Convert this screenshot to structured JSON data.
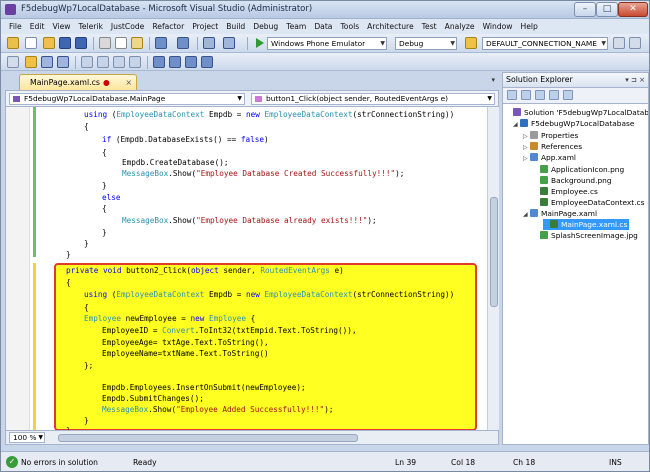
{
  "window": {
    "title": "F5debugWp7LocalDatabase - Microsoft Visual Studio (Administrator)"
  },
  "menu": [
    "File",
    "Edit",
    "View",
    "Telerik",
    "JustCode",
    "Refactor",
    "Project",
    "Build",
    "Debug",
    "Team",
    "Data",
    "Tools",
    "Architecture",
    "Test",
    "Analyze",
    "Window",
    "Help"
  ],
  "toolbar": {
    "target_device": "Windows Phone Emulator",
    "configuration": "Debug",
    "find_box": "DEFAULT_CONNECTION_NAME"
  },
  "editor": {
    "tab_label": "MainPage.xaml.cs",
    "tab_modified": "●",
    "tab_close": "×",
    "tab_overflow": "▾",
    "nav_class": "F5debugWp7LocalDatabase.MainPage",
    "nav_member": "button1_Click(object sender, RoutedEventArgs e)",
    "zoom": "100 %"
  },
  "code_lines": [
    [
      [
        "kw",
        "using "
      ],
      [
        "tx",
        "("
      ],
      [
        "ty",
        "EmployeeDataContext"
      ],
      [
        "tx",
        " Empdb = "
      ],
      [
        "kw",
        "new "
      ],
      [
        "ty",
        "EmployeeDataContext"
      ],
      [
        "tx",
        "(strConnectionString))"
      ]
    ],
    [
      [
        "tx",
        "{"
      ]
    ],
    [
      [
        "kw",
        "if "
      ],
      [
        "tx",
        "(Empdb.DatabaseExists() == "
      ],
      [
        "kw",
        "false"
      ],
      [
        "tx",
        ")"
      ]
    ],
    [
      [
        "tx",
        "{"
      ]
    ],
    [
      [
        "tx",
        "Empdb.CreateDatabase();"
      ]
    ],
    [
      [
        "ty",
        "MessageBox"
      ],
      [
        "tx",
        ".Show("
      ],
      [
        "str",
        "\"Employee Database Created Successfully!!!\""
      ],
      [
        "tx",
        ");"
      ]
    ],
    [
      [
        "tx",
        "}"
      ]
    ],
    [
      [
        "kw",
        "else"
      ]
    ],
    [
      [
        "tx",
        "{"
      ]
    ],
    [
      [
        "ty",
        "MessageBox"
      ],
      [
        "tx",
        ".Show("
      ],
      [
        "str",
        "\"Employee Database already exists!!!\""
      ],
      [
        "tx",
        ");"
      ]
    ],
    [
      [
        "tx",
        "}"
      ]
    ],
    [
      [
        "tx",
        "}"
      ]
    ],
    [
      [
        "tx",
        "}"
      ]
    ],
    [
      [
        "tx",
        ""
      ]
    ],
    [
      [
        "kw",
        "private void "
      ],
      [
        "tx",
        "button2_Click("
      ],
      [
        "kw",
        "object "
      ],
      [
        "tx",
        "sender, "
      ],
      [
        "ty",
        "RoutedEventArgs "
      ],
      [
        "tx",
        "e)"
      ]
    ],
    [
      [
        "tx",
        "{"
      ]
    ],
    [
      [
        "kw",
        "using "
      ],
      [
        "tx",
        "("
      ],
      [
        "ty",
        "EmployeeDataContext"
      ],
      [
        "tx",
        " Empdb = "
      ],
      [
        "kw",
        "new "
      ],
      [
        "ty",
        "EmployeeDataContext"
      ],
      [
        "tx",
        "(strConnectionString))"
      ]
    ],
    [
      [
        "tx",
        "{"
      ]
    ],
    [
      [
        "ty",
        "Employee "
      ],
      [
        "tx",
        "newEmployee = "
      ],
      [
        "kw",
        "new "
      ],
      [
        "ty",
        "Employee "
      ],
      [
        "tx",
        "{"
      ]
    ],
    [
      [
        "tx",
        "EmployeeID = "
      ],
      [
        "ty",
        "Convert"
      ],
      [
        "tx",
        ".ToInt32(txtEmpid.Text.ToString()),"
      ]
    ],
    [
      [
        "tx",
        "EmployeeAge= txtAge.Text.ToString(),"
      ]
    ],
    [
      [
        "tx",
        "EmployeeName=txtName.Text.ToString()"
      ]
    ],
    [
      [
        "tx",
        "};"
      ]
    ],
    [
      [
        "tx",
        ""
      ]
    ],
    [
      [
        "tx",
        "Empdb.Employees.InsertOnSubmit(newEmployee);"
      ]
    ],
    [
      [
        "tx",
        "Empdb.SubmitChanges();"
      ]
    ],
    [
      [
        "ty",
        "MessageBox"
      ],
      [
        "tx",
        ".Show("
      ],
      [
        "str",
        "\"Employee Added Successfully!!!\""
      ],
      [
        "tx",
        ");"
      ]
    ],
    [
      [
        "tx",
        "}"
      ]
    ],
    [
      [
        "tx",
        "}"
      ]
    ]
  ],
  "solution_explorer": {
    "title": "Solution Explorer",
    "controls": "▾ ⊐ ×",
    "items": [
      {
        "label": "Solution 'F5debugWp7LocalDatabase'",
        "icon": "solution-icon",
        "exp": ""
      },
      {
        "label": "F5debugWp7LocalDatabase",
        "icon": "project-icon",
        "exp": "◢"
      },
      {
        "label": "Properties",
        "icon": "properties-icon",
        "exp": "▷"
      },
      {
        "label": "References",
        "icon": "references-icon",
        "exp": "▷"
      },
      {
        "label": "App.xaml",
        "icon": "xaml-file-icon",
        "exp": "▷"
      },
      {
        "label": "ApplicationIcon.png",
        "icon": "image-file-icon",
        "exp": ""
      },
      {
        "label": "Background.png",
        "icon": "image-file-icon",
        "exp": ""
      },
      {
        "label": "Employee.cs",
        "icon": "cs-file-icon",
        "exp": ""
      },
      {
        "label": "EmployeeDataContext.cs",
        "icon": "cs-file-icon",
        "exp": ""
      },
      {
        "label": "MainPage.xaml",
        "icon": "xaml-file-icon",
        "exp": "◢"
      },
      {
        "label": "MainPage.xaml.cs",
        "icon": "cs-file-icon",
        "exp": ""
      },
      {
        "label": "SplashScreenImage.jpg",
        "icon": "image-file-icon",
        "exp": ""
      }
    ]
  },
  "status": {
    "errors": "No errors in solution",
    "state": "Ready",
    "line": "Ln 39",
    "col": "Col 18",
    "ch": "Ch 18",
    "mode": "INS"
  },
  "colors": {
    "highlight": "#ffff22",
    "highlight_border": "#e23a2e",
    "keyword": "#0000ff",
    "type": "#2b91af",
    "string": "#a31515"
  }
}
